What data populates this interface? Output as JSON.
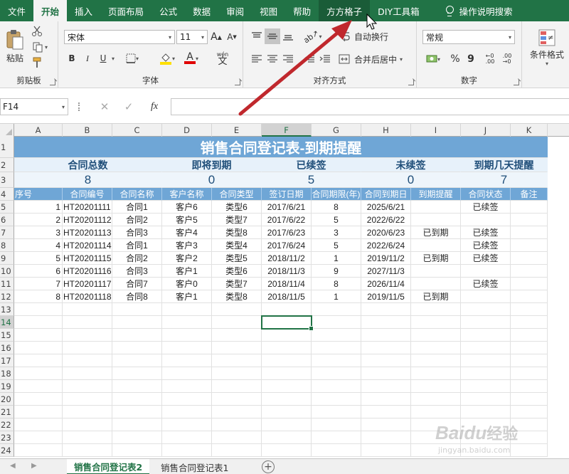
{
  "menu": {
    "items": [
      "文件",
      "开始",
      "插入",
      "页面布局",
      "公式",
      "数据",
      "审阅",
      "视图",
      "帮助",
      "方方格子",
      "DIY工具箱"
    ],
    "active": "开始",
    "hovered": "方方格子",
    "tell_me": "操作说明搜索"
  },
  "ribbon": {
    "clipboard": {
      "paste": "粘贴",
      "label": "剪贴板"
    },
    "font": {
      "name": "宋体",
      "size": "11",
      "bold": "B",
      "italic": "I",
      "underline": "U",
      "label": "字体",
      "wen": "wén",
      "wen_char": "文"
    },
    "align": {
      "wrap": "自动换行",
      "merge": "合并后居中",
      "label": "对齐方式"
    },
    "number": {
      "format": "常规",
      "percent": "%",
      "comma": "9",
      "label": "数字"
    },
    "styles": {
      "conditional": "条件格式"
    }
  },
  "formula_bar": {
    "name_box": "F14",
    "fx": "fx"
  },
  "columns": [
    "A",
    "B",
    "C",
    "D",
    "E",
    "F",
    "G",
    "H",
    "I",
    "J",
    "K"
  ],
  "selected_column": "F",
  "rows": [
    "1",
    "2",
    "3",
    "4",
    "5",
    "6",
    "7",
    "8",
    "9",
    "10",
    "11",
    "12",
    "13",
    "14",
    "15",
    "16",
    "17",
    "18",
    "19",
    "20",
    "21",
    "22",
    "23",
    "24"
  ],
  "selected_row": "14",
  "sheet": {
    "title": "销售合同登记表-到期提醒",
    "summary_labels": [
      "合同总数",
      "即将到期",
      "已续签",
      "未续签",
      "到期几天提醒"
    ],
    "summary_values": [
      "8",
      "0",
      "5",
      "0",
      "7"
    ],
    "headers": [
      "序号",
      "合同编号",
      "合同名称",
      "客户名称",
      "合同类型",
      "签订日期",
      "合同期限(年)",
      "合同到期日",
      "到期提醒",
      "合同状态",
      "备注"
    ],
    "data": [
      [
        "1",
        "HT20201111",
        "合同1",
        "客户6",
        "类型6",
        "2017/6/21",
        "8",
        "2025/6/21",
        "",
        "已续签",
        ""
      ],
      [
        "2",
        "HT20201112",
        "合同2",
        "客户5",
        "类型7",
        "2017/6/22",
        "5",
        "2022/6/22",
        "",
        "",
        ""
      ],
      [
        "3",
        "HT20201113",
        "合同3",
        "客户4",
        "类型8",
        "2017/6/23",
        "3",
        "2020/6/23",
        "已到期",
        "已续签",
        ""
      ],
      [
        "4",
        "HT20201114",
        "合同1",
        "客户3",
        "类型4",
        "2017/6/24",
        "5",
        "2022/6/24",
        "",
        "已续签",
        ""
      ],
      [
        "5",
        "HT20201115",
        "合同2",
        "客户2",
        "类型5",
        "2018/11/2",
        "1",
        "2019/11/2",
        "已到期",
        "已续签",
        ""
      ],
      [
        "6",
        "HT20201116",
        "合同3",
        "客户1",
        "类型6",
        "2018/11/3",
        "9",
        "2027/11/3",
        "",
        "",
        ""
      ],
      [
        "7",
        "HT20201117",
        "合同7",
        "客户0",
        "类型7",
        "2018/11/4",
        "8",
        "2026/11/4",
        "",
        "已续签",
        ""
      ],
      [
        "8",
        "HT20201118",
        "合同8",
        "客户1",
        "类型8",
        "2018/11/5",
        "1",
        "2019/11/5",
        "已到期",
        "",
        ""
      ]
    ]
  },
  "tabs": [
    "销售合同登记表2",
    "销售合同登记表1"
  ],
  "active_tab": "销售合同登记表2",
  "watermark": {
    "brand": "Baidu",
    "cn": "经验",
    "url": "jingyan.baidu.com"
  },
  "colors": {
    "excel_green": "#217346",
    "header_blue": "#6fa6d6",
    "arrow_red": "#c0282d"
  }
}
